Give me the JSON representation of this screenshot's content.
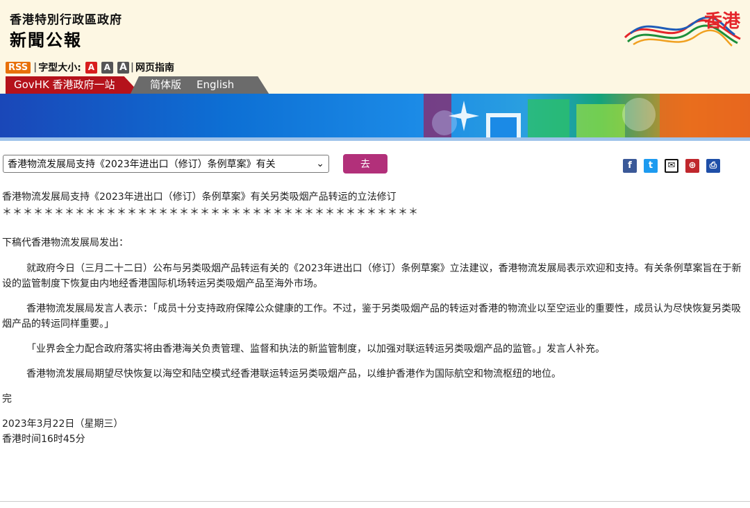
{
  "header": {
    "gov_title": "香港特別行政區政府",
    "gov_subtitle": "新聞公報",
    "brand_text": "香港"
  },
  "toolbar": {
    "rss_label": "RSS",
    "font_size_label": "字型大小:",
    "font_a": "A",
    "web_guide_label": "网页指南"
  },
  "nav": {
    "govhk": "GovHK 香港政府一站通",
    "simplified": "简体版",
    "english": "English"
  },
  "controls": {
    "select_value": "香港物流发展局支持《2023年进出口（修订）条例草案》有关",
    "go_label": "去"
  },
  "share": {
    "facebook": "f",
    "twitter": "t",
    "email": "✉",
    "bookmark": "⊕",
    "print": "⎙"
  },
  "article": {
    "title": "香港物流发展局支持《2023年进出口（修订）条例草案》有关另类吸烟产品转运的立法修订",
    "stars": "＊＊＊＊＊＊＊＊＊＊＊＊＊＊＊＊＊＊＊＊＊＊＊＊＊＊＊＊＊＊＊＊＊＊＊＊＊＊＊＊",
    "intro": "下稿代香港物流发展局发出：",
    "p1": "就政府今日（三月二十二日）公布与另类吸烟产品转运有关的《2023年进出口（修订）条例草案》立法建议，香港物流发展局表示欢迎和支持。有关条例草案旨在于新设的监管制度下恢复由内地经香港国际机场转运另类吸烟产品至海外市场。",
    "p2": "香港物流发展局发言人表示：「成员十分支持政府保障公众健康的工作。不过，鉴于另类吸烟产品的转运对香港的物流业以至空运业的重要性，成员认为尽快恢复另类吸烟产品的转运同样重要。」",
    "p3": "「业界会全力配合政府落实将由香港海关负责管理、监督和执法的新监管制度，以加强对联运转运另类吸烟产品的监管。」发言人补充。",
    "p4": "香港物流发展局期望尽快恢复以海空和陆空模式经香港联运转运另类吸烟产品，以维护香港作为国际航空和物流枢纽的地位。",
    "end": "完",
    "date": "2023年3月22日（星期三）",
    "time": "香港时间16时45分"
  }
}
